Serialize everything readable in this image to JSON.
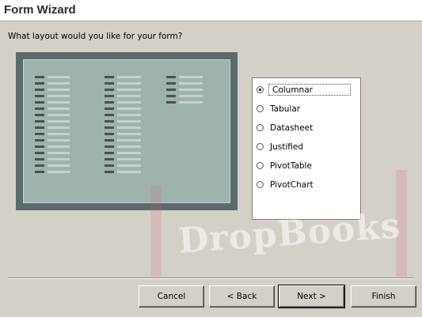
{
  "window": {
    "title": "Form Wizard"
  },
  "question": "What layout would you like for your form?",
  "layout_options": [
    {
      "label": "Columnar",
      "selected": true
    },
    {
      "label": "Tabular",
      "selected": false
    },
    {
      "label": "Datasheet",
      "selected": false
    },
    {
      "label": "Justified",
      "selected": false
    },
    {
      "label": "PivotTable",
      "selected": false
    },
    {
      "label": "PivotChart",
      "selected": false
    }
  ],
  "buttons": {
    "cancel": "Cancel",
    "back": "< Back",
    "next": "Next >",
    "finish": "Finish"
  },
  "watermark": "DropBooks",
  "colors": {
    "dialog_bg": "#d4d0c8",
    "preview_frame": "#5b6b6b",
    "preview_fill": "#9fb3ae"
  }
}
